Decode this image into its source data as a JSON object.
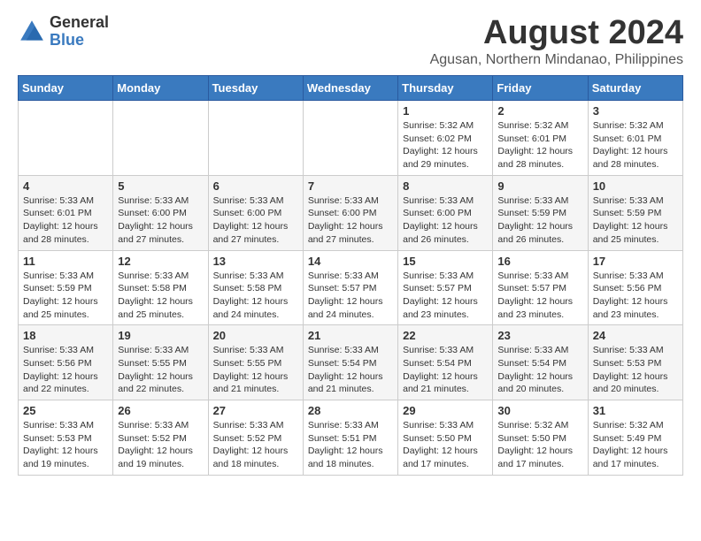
{
  "logo": {
    "general": "General",
    "blue": "Blue"
  },
  "title": "August 2024",
  "subtitle": "Agusan, Northern Mindanao, Philippines",
  "days_of_week": [
    "Sunday",
    "Monday",
    "Tuesday",
    "Wednesday",
    "Thursday",
    "Friday",
    "Saturday"
  ],
  "weeks": [
    [
      {
        "day": "",
        "sunrise": "",
        "sunset": "",
        "daylight": ""
      },
      {
        "day": "",
        "sunrise": "",
        "sunset": "",
        "daylight": ""
      },
      {
        "day": "",
        "sunrise": "",
        "sunset": "",
        "daylight": ""
      },
      {
        "day": "",
        "sunrise": "",
        "sunset": "",
        "daylight": ""
      },
      {
        "day": "1",
        "sunrise": "Sunrise: 5:32 AM",
        "sunset": "Sunset: 6:02 PM",
        "daylight": "Daylight: 12 hours and 29 minutes."
      },
      {
        "day": "2",
        "sunrise": "Sunrise: 5:32 AM",
        "sunset": "Sunset: 6:01 PM",
        "daylight": "Daylight: 12 hours and 28 minutes."
      },
      {
        "day": "3",
        "sunrise": "Sunrise: 5:32 AM",
        "sunset": "Sunset: 6:01 PM",
        "daylight": "Daylight: 12 hours and 28 minutes."
      }
    ],
    [
      {
        "day": "4",
        "sunrise": "Sunrise: 5:33 AM",
        "sunset": "Sunset: 6:01 PM",
        "daylight": "Daylight: 12 hours and 28 minutes."
      },
      {
        "day": "5",
        "sunrise": "Sunrise: 5:33 AM",
        "sunset": "Sunset: 6:00 PM",
        "daylight": "Daylight: 12 hours and 27 minutes."
      },
      {
        "day": "6",
        "sunrise": "Sunrise: 5:33 AM",
        "sunset": "Sunset: 6:00 PM",
        "daylight": "Daylight: 12 hours and 27 minutes."
      },
      {
        "day": "7",
        "sunrise": "Sunrise: 5:33 AM",
        "sunset": "Sunset: 6:00 PM",
        "daylight": "Daylight: 12 hours and 27 minutes."
      },
      {
        "day": "8",
        "sunrise": "Sunrise: 5:33 AM",
        "sunset": "Sunset: 6:00 PM",
        "daylight": "Daylight: 12 hours and 26 minutes."
      },
      {
        "day": "9",
        "sunrise": "Sunrise: 5:33 AM",
        "sunset": "Sunset: 5:59 PM",
        "daylight": "Daylight: 12 hours and 26 minutes."
      },
      {
        "day": "10",
        "sunrise": "Sunrise: 5:33 AM",
        "sunset": "Sunset: 5:59 PM",
        "daylight": "Daylight: 12 hours and 25 minutes."
      }
    ],
    [
      {
        "day": "11",
        "sunrise": "Sunrise: 5:33 AM",
        "sunset": "Sunset: 5:59 PM",
        "daylight": "Daylight: 12 hours and 25 minutes."
      },
      {
        "day": "12",
        "sunrise": "Sunrise: 5:33 AM",
        "sunset": "Sunset: 5:58 PM",
        "daylight": "Daylight: 12 hours and 25 minutes."
      },
      {
        "day": "13",
        "sunrise": "Sunrise: 5:33 AM",
        "sunset": "Sunset: 5:58 PM",
        "daylight": "Daylight: 12 hours and 24 minutes."
      },
      {
        "day": "14",
        "sunrise": "Sunrise: 5:33 AM",
        "sunset": "Sunset: 5:57 PM",
        "daylight": "Daylight: 12 hours and 24 minutes."
      },
      {
        "day": "15",
        "sunrise": "Sunrise: 5:33 AM",
        "sunset": "Sunset: 5:57 PM",
        "daylight": "Daylight: 12 hours and 23 minutes."
      },
      {
        "day": "16",
        "sunrise": "Sunrise: 5:33 AM",
        "sunset": "Sunset: 5:57 PM",
        "daylight": "Daylight: 12 hours and 23 minutes."
      },
      {
        "day": "17",
        "sunrise": "Sunrise: 5:33 AM",
        "sunset": "Sunset: 5:56 PM",
        "daylight": "Daylight: 12 hours and 23 minutes."
      }
    ],
    [
      {
        "day": "18",
        "sunrise": "Sunrise: 5:33 AM",
        "sunset": "Sunset: 5:56 PM",
        "daylight": "Daylight: 12 hours and 22 minutes."
      },
      {
        "day": "19",
        "sunrise": "Sunrise: 5:33 AM",
        "sunset": "Sunset: 5:55 PM",
        "daylight": "Daylight: 12 hours and 22 minutes."
      },
      {
        "day": "20",
        "sunrise": "Sunrise: 5:33 AM",
        "sunset": "Sunset: 5:55 PM",
        "daylight": "Daylight: 12 hours and 21 minutes."
      },
      {
        "day": "21",
        "sunrise": "Sunrise: 5:33 AM",
        "sunset": "Sunset: 5:54 PM",
        "daylight": "Daylight: 12 hours and 21 minutes."
      },
      {
        "day": "22",
        "sunrise": "Sunrise: 5:33 AM",
        "sunset": "Sunset: 5:54 PM",
        "daylight": "Daylight: 12 hours and 21 minutes."
      },
      {
        "day": "23",
        "sunrise": "Sunrise: 5:33 AM",
        "sunset": "Sunset: 5:54 PM",
        "daylight": "Daylight: 12 hours and 20 minutes."
      },
      {
        "day": "24",
        "sunrise": "Sunrise: 5:33 AM",
        "sunset": "Sunset: 5:53 PM",
        "daylight": "Daylight: 12 hours and 20 minutes."
      }
    ],
    [
      {
        "day": "25",
        "sunrise": "Sunrise: 5:33 AM",
        "sunset": "Sunset: 5:53 PM",
        "daylight": "Daylight: 12 hours and 19 minutes."
      },
      {
        "day": "26",
        "sunrise": "Sunrise: 5:33 AM",
        "sunset": "Sunset: 5:52 PM",
        "daylight": "Daylight: 12 hours and 19 minutes."
      },
      {
        "day": "27",
        "sunrise": "Sunrise: 5:33 AM",
        "sunset": "Sunset: 5:52 PM",
        "daylight": "Daylight: 12 hours and 18 minutes."
      },
      {
        "day": "28",
        "sunrise": "Sunrise: 5:33 AM",
        "sunset": "Sunset: 5:51 PM",
        "daylight": "Daylight: 12 hours and 18 minutes."
      },
      {
        "day": "29",
        "sunrise": "Sunrise: 5:33 AM",
        "sunset": "Sunset: 5:50 PM",
        "daylight": "Daylight: 12 hours and 17 minutes."
      },
      {
        "day": "30",
        "sunrise": "Sunrise: 5:32 AM",
        "sunset": "Sunset: 5:50 PM",
        "daylight": "Daylight: 12 hours and 17 minutes."
      },
      {
        "day": "31",
        "sunrise": "Sunrise: 5:32 AM",
        "sunset": "Sunset: 5:49 PM",
        "daylight": "Daylight: 12 hours and 17 minutes."
      }
    ]
  ]
}
